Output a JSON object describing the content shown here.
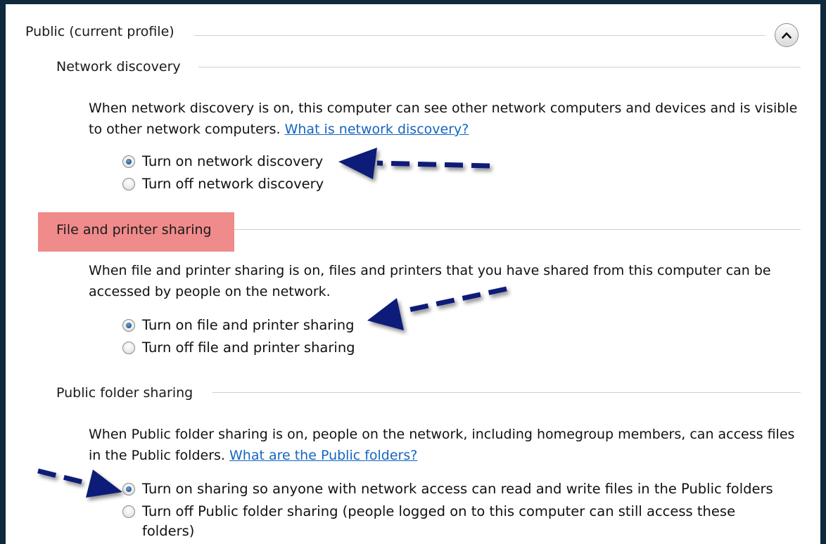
{
  "profile": {
    "title": "Public (current profile)",
    "collapse_icon": "chevron-up-icon"
  },
  "network_discovery": {
    "heading": "Network discovery",
    "description": "When network discovery is on, this computer can see other network computers and devices and is visible to other network computers.",
    "link": "What is network discovery?",
    "options": [
      {
        "label": "Turn on network discovery",
        "checked": true
      },
      {
        "label": "Turn off network discovery",
        "checked": false
      }
    ]
  },
  "file_printer_sharing": {
    "heading": "File and printer sharing",
    "highlight_color": "#f08b8b",
    "description": "When file and printer sharing is on, files and printers that you have shared from this computer can be accessed by people on the network.",
    "options": [
      {
        "label": "Turn on file and printer sharing",
        "checked": true
      },
      {
        "label": "Turn off file and printer sharing",
        "checked": false
      }
    ]
  },
  "public_folder_sharing": {
    "heading": "Public folder sharing",
    "description": "When Public folder sharing is on, people on the network, including homegroup members, can access files in the Public folders.",
    "link": "What are the Public folders?",
    "options": [
      {
        "label": "Turn on sharing so anyone with network access can read and write files in the Public folders",
        "checked": true
      },
      {
        "label": "Turn off Public folder sharing (people logged on to this computer can still access these folders)",
        "checked": false
      }
    ]
  },
  "annotations": {
    "arrow_color": "#0b1a78",
    "arrow_count": 3
  }
}
